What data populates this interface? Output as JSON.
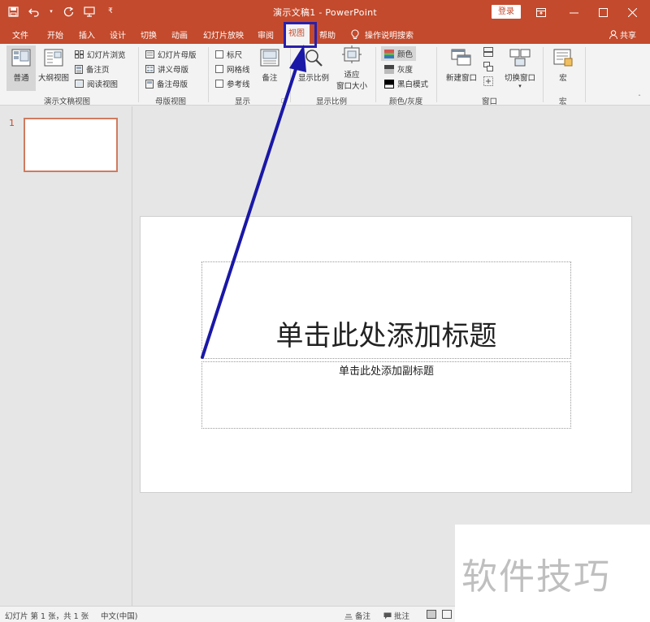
{
  "window": {
    "title": "演示文稿1  -  PowerPoint",
    "login_label": "登录",
    "share_label": "共享"
  },
  "tabs": [
    {
      "label": "文件"
    },
    {
      "label": "开始"
    },
    {
      "label": "插入"
    },
    {
      "label": "设计"
    },
    {
      "label": "切换"
    },
    {
      "label": "动画"
    },
    {
      "label": "幻灯片放映"
    },
    {
      "label": "审阅"
    },
    {
      "label": "视图"
    },
    {
      "label": "帮助"
    },
    {
      "label": "操作说明搜索"
    }
  ],
  "ribbon": {
    "groups": {
      "presentation_views": "演示文稿视图",
      "master_views": "母版视图",
      "show": "显示",
      "zoom": "显示比例",
      "color": "颜色/灰度",
      "window": "窗口",
      "macros": "宏"
    },
    "normal": "普通",
    "outline": "大纲视图",
    "slide_sorter": "幻灯片浏览",
    "notes_page": "备注页",
    "reading_view": "阅读视图",
    "slide_master": "幻灯片母版",
    "handout_master": "讲义母版",
    "notes_master": "备注母版",
    "ruler": "标尺",
    "gridlines": "网格线",
    "guides": "参考线",
    "notes": "备注",
    "zoom": "显示比例",
    "fit_line1": "适应",
    "fit_line2": "窗口大小",
    "color": "颜色",
    "grayscale": "灰度",
    "bw": "黑白模式",
    "new_window": "新建窗口",
    "switch_windows": "切换窗口",
    "macros": "宏"
  },
  "thumbnails": [
    {
      "number": "1"
    }
  ],
  "slide": {
    "title_placeholder": "单击此处添加标题",
    "subtitle_placeholder": "单击此处添加副标题"
  },
  "status": {
    "slide_info": "幻灯片 第 1 张，共 1 张",
    "language": "中文(中国)",
    "notes": "备注",
    "comments": "批注"
  },
  "watermark": "软件技巧",
  "colors": {
    "accent": "#c34a2c",
    "highlight_box": "#2a1fa8",
    "arrow": "#1a18a6"
  }
}
